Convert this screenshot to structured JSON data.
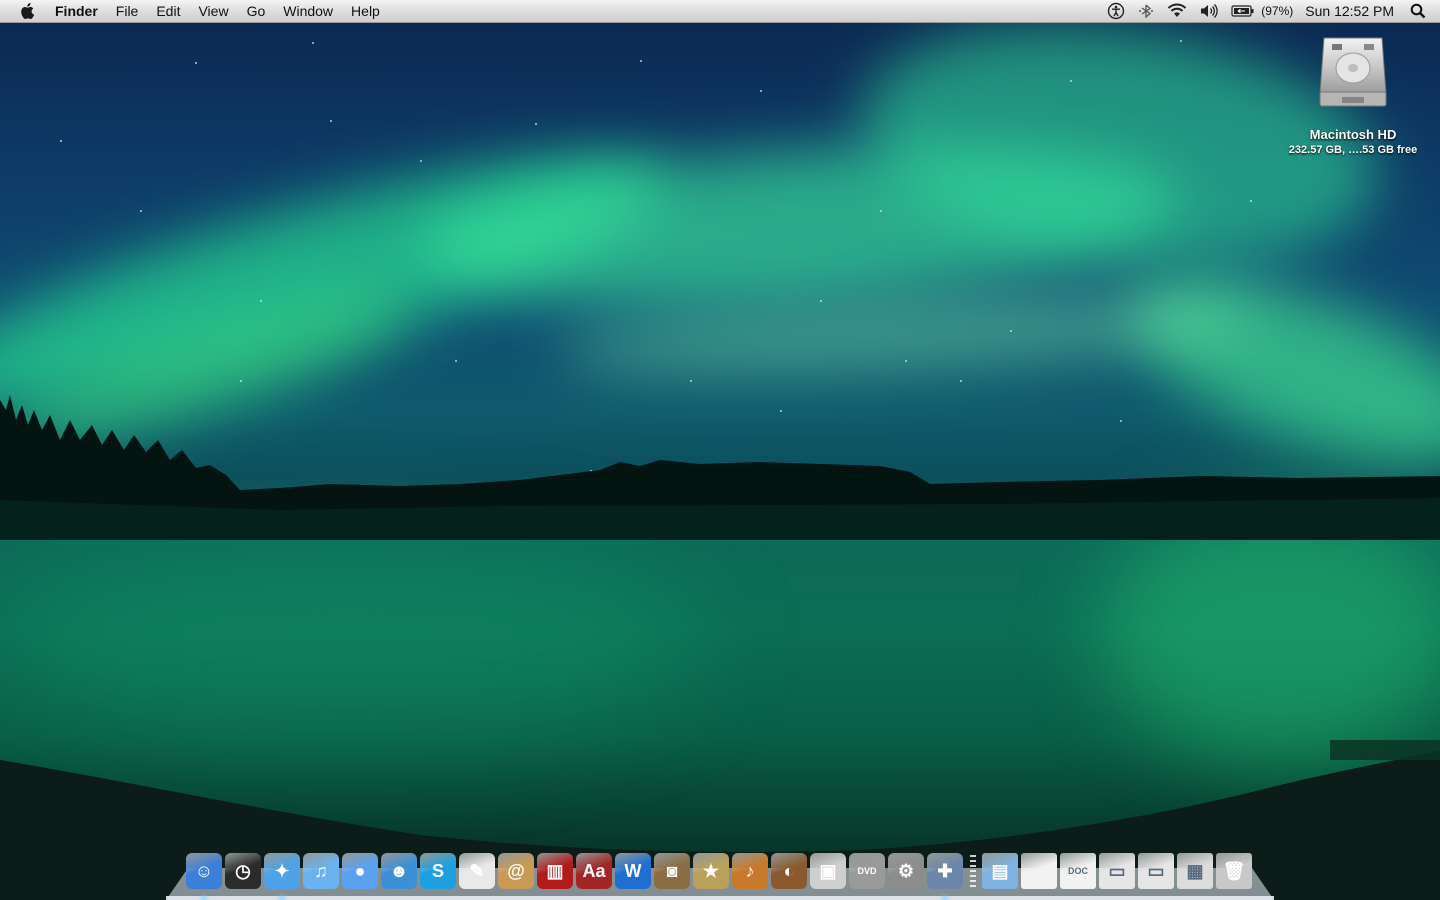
{
  "menubar": {
    "app_name": "Finder",
    "menus": [
      "File",
      "Edit",
      "View",
      "Go",
      "Window",
      "Help"
    ],
    "status": {
      "battery_percent": "(97%)",
      "clock": "Sun 12:52 PM",
      "icons": [
        "accessibility-icon",
        "bluetooth-icon",
        "wifi-icon",
        "volume-icon",
        "battery-icon",
        "spotlight-icon"
      ]
    }
  },
  "desktop": {
    "drive": {
      "name": "Macintosh HD",
      "info": "232.57 GB, ….53 GB free"
    }
  },
  "dock": {
    "apps": [
      {
        "name": "finder",
        "color": "#3b7fd8",
        "glyph": "☺",
        "running": true
      },
      {
        "name": "dashboard",
        "color": "#2b2b2b",
        "glyph": "◷",
        "running": false
      },
      {
        "name": "safari",
        "color": "#4fa2e8",
        "glyph": "✦",
        "running": true
      },
      {
        "name": "itunes",
        "color": "#6bb3f0",
        "glyph": "♫",
        "running": false
      },
      {
        "name": "ichat",
        "color": "#5aa2f0",
        "glyph": "●",
        "running": false
      },
      {
        "name": "messenger",
        "color": "#3d8fd6",
        "glyph": "☻",
        "running": false
      },
      {
        "name": "skype",
        "color": "#1ea0e0",
        "glyph": "S",
        "running": false
      },
      {
        "name": "textedit",
        "color": "#e9e9e9",
        "glyph": "✎",
        "running": false
      },
      {
        "name": "address-book",
        "color": "#c99a55",
        "glyph": "@",
        "running": false
      },
      {
        "name": "photo-booth",
        "color": "#b11b1b",
        "glyph": "▥",
        "running": false
      },
      {
        "name": "dictionary",
        "color": "#a32626",
        "glyph": "Aa",
        "running": false
      },
      {
        "name": "word",
        "color": "#1f6fd1",
        "glyph": "W",
        "running": false
      },
      {
        "name": "iphoto",
        "color": "#8a6d44",
        "glyph": "◙",
        "running": false
      },
      {
        "name": "imovie",
        "color": "#b9a15c",
        "glyph": "★",
        "running": false
      },
      {
        "name": "garageband",
        "color": "#c9792b",
        "glyph": "♪",
        "running": false
      },
      {
        "name": "coconut-battery",
        "color": "#8a5a2e",
        "glyph": "◐",
        "running": false
      },
      {
        "name": "image-capture",
        "color": "#cfcfcf",
        "glyph": "▣",
        "running": false
      },
      {
        "name": "dvd-player",
        "color": "#9a9a9a",
        "glyph": "DVD",
        "running": false
      },
      {
        "name": "system-preferences",
        "color": "#8d8d8d",
        "glyph": "⚙",
        "running": false
      },
      {
        "name": "preview",
        "color": "#6b86a8",
        "glyph": "✚",
        "running": true
      }
    ],
    "stacks": [
      {
        "name": "documents-folder",
        "color": "#7fb2e0",
        "glyph": "▤"
      },
      {
        "name": "blank-document",
        "color": "#f2f2f2",
        "glyph": ""
      },
      {
        "name": "doc-file",
        "color": "#f2f2f2",
        "glyph": "DOC"
      },
      {
        "name": "downloads-stack",
        "color": "#e6e6e6",
        "glyph": "▭"
      },
      {
        "name": "web-location-stack",
        "color": "#e6e6e6",
        "glyph": "▭"
      },
      {
        "name": "applications-stack",
        "color": "#dcdcdc",
        "glyph": "▦"
      },
      {
        "name": "trash",
        "color": "#c8c8c8",
        "glyph": "🗑"
      }
    ]
  }
}
